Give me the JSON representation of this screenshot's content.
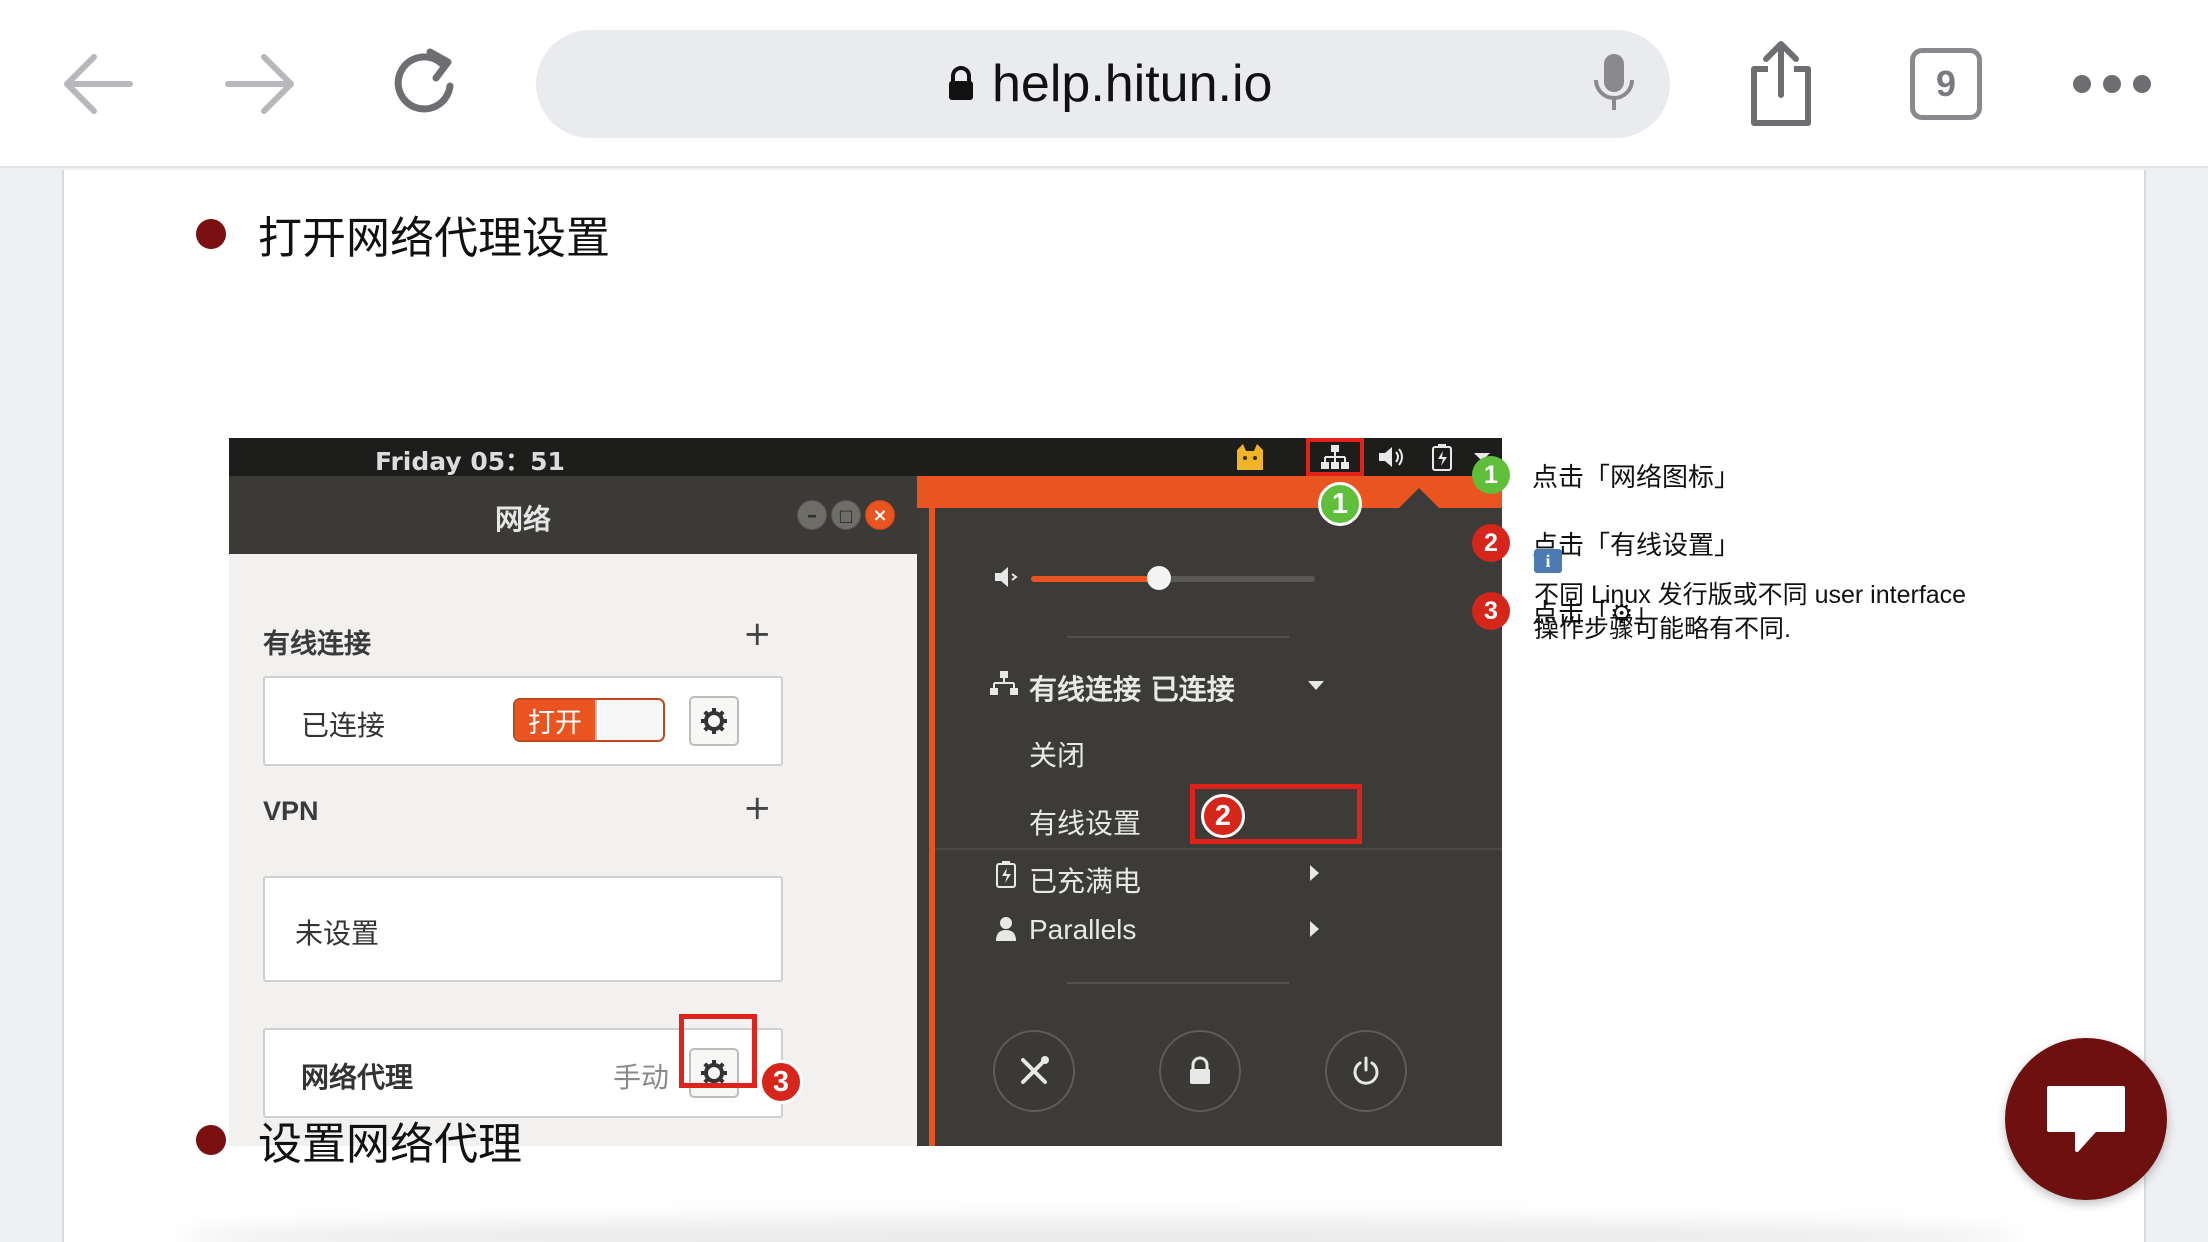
{
  "browser": {
    "url": "help.hitun.io",
    "tab_count": "9"
  },
  "page": {
    "sections": [
      {
        "title": "打开网络代理设置"
      },
      {
        "title": "设置网络代理"
      }
    ]
  },
  "screenshot": {
    "clock": "Friday 05：51",
    "window_title": "网络",
    "wired": {
      "title": "有线连接",
      "plus": "+",
      "status": "已连接",
      "switch_label": "打开"
    },
    "vpn": {
      "title": "VPN",
      "plus": "+",
      "status": "未设置"
    },
    "proxy": {
      "title": "网络代理",
      "mode": "手动"
    },
    "menu": {
      "wired_connected": "有线连接 已连接",
      "close": "关闭",
      "wired_settings": "有线设置",
      "battery": "已充满电",
      "user": "Parallels",
      "volume_level": 0.45
    },
    "badges": [
      "1",
      "2",
      "3"
    ]
  },
  "legend": {
    "items": [
      {
        "num": "1",
        "text": "点击「网络图标」",
        "color": "#5fbf3a"
      },
      {
        "num": "2",
        "text": "点击「有线设置」",
        "color": "#d6261c"
      },
      {
        "num": "3",
        "text": "点击「⚙」",
        "color": "#d6261c"
      }
    ],
    "info_icon": "i",
    "note": "不同 Linux 发行版或不同 user interface 操作步骤可能略有不同."
  },
  "colors": {
    "ubuntu_orange": "#e95420",
    "highlight_red": "#e0231a",
    "bullet": "#7a1010",
    "chat_button": "#6e0f10"
  }
}
